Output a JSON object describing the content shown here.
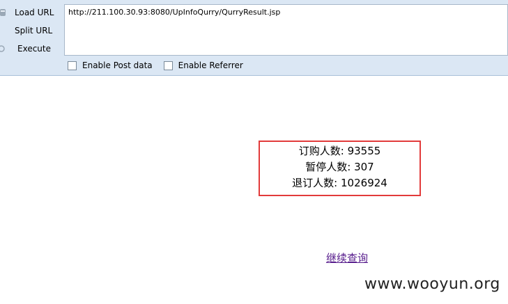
{
  "toolbar": {
    "load_url": "Load URL",
    "split_url": "Split URL",
    "execute": "Execute",
    "url_value": "http://211.100.30.93:8080/UpInfoQurry/QurryResult.jsp",
    "enable_post": "Enable Post data",
    "enable_referrer": "Enable Referrer"
  },
  "result": {
    "rows": [
      {
        "label": "订购人数:",
        "value": "93555"
      },
      {
        "label": "暂停人数:",
        "value": "307"
      },
      {
        "label": "退订人数:",
        "value": "1026924"
      }
    ]
  },
  "link": "继续查询",
  "watermark": "www.wooyun.org"
}
